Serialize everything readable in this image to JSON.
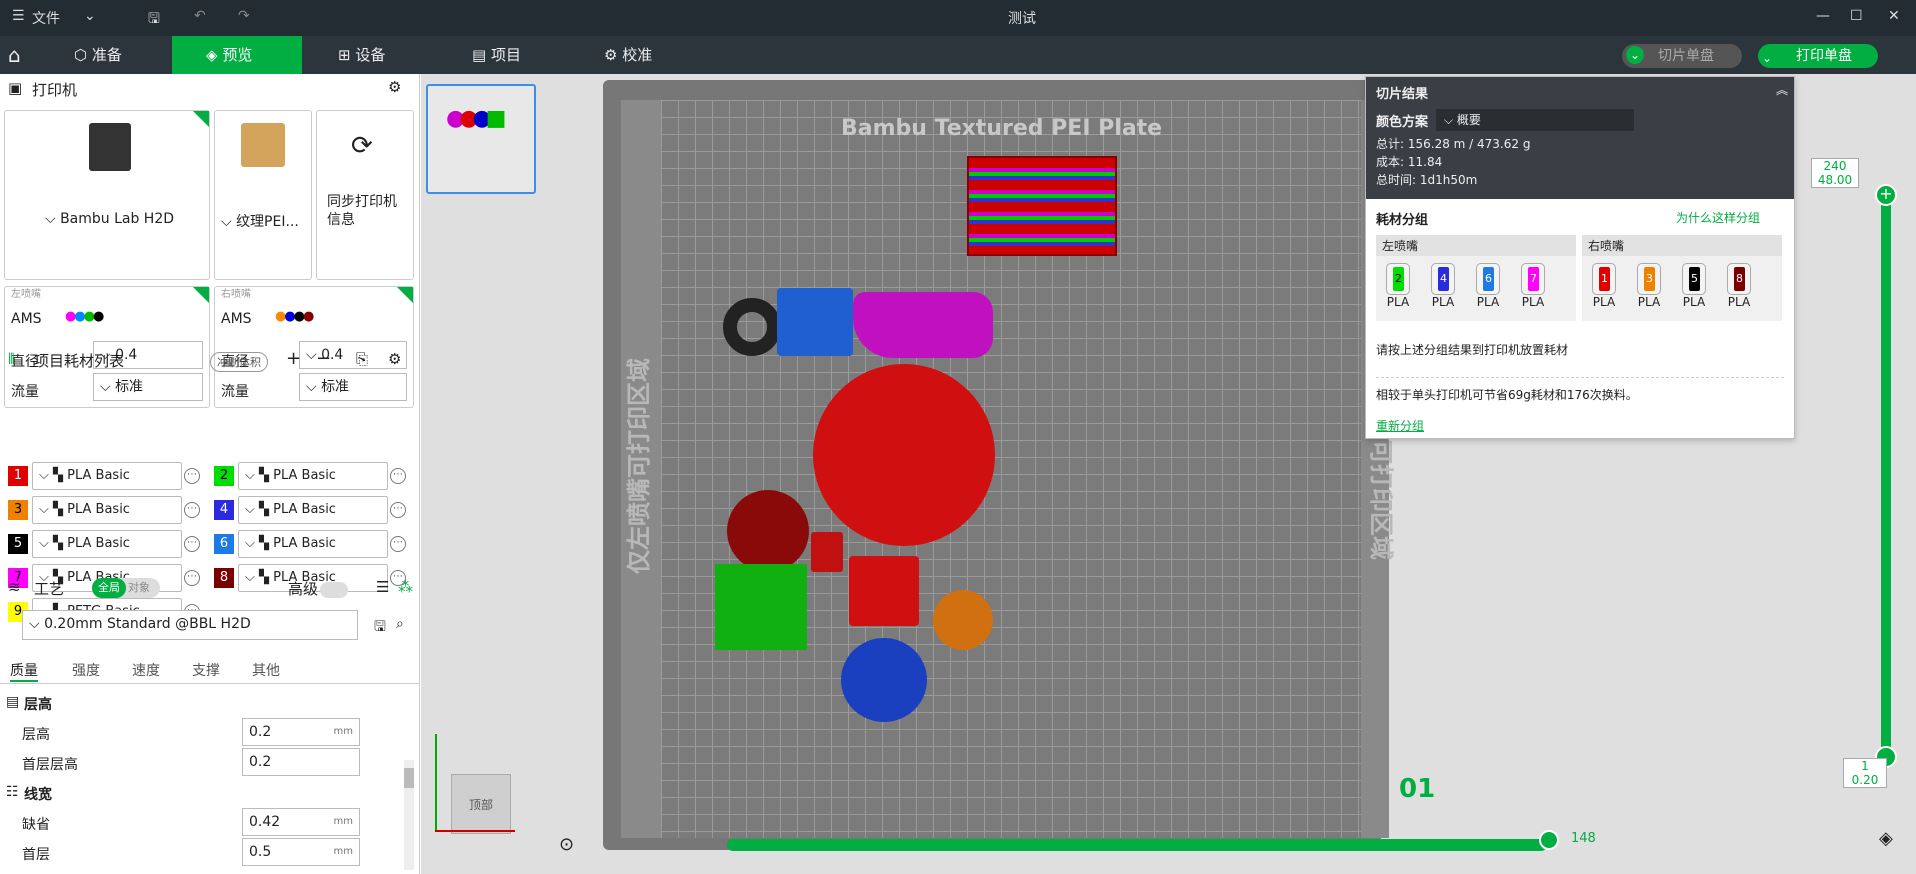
{
  "titlebar": {
    "file_menu": "文件",
    "title": "测试"
  },
  "tabs": {
    "home": "",
    "prepare": "准备",
    "preview": "预览",
    "device": "设备",
    "project": "项目",
    "calibrate": "校准"
  },
  "actions": {
    "slice_plate": "切片单盘",
    "print_plate": "打印单盘"
  },
  "printer": {
    "section": "打印机",
    "model": "Bambu Lab H2D",
    "plate": "纹理PEI...",
    "sync": "同步打印机信息"
  },
  "nozzles": {
    "left": {
      "label": "左喷嘴",
      "ams": "AMS",
      "diameter_label": "直径",
      "diameter": "0.4",
      "flow_label": "流量",
      "flow": "标准"
    },
    "right": {
      "label": "右喷嘴",
      "ams": "AMS",
      "diameter_label": "直径",
      "diameter": "0.4",
      "flow_label": "流量",
      "flow": "标准"
    }
  },
  "filaments": {
    "section": "项目耗材列表",
    "flush": "冲刷体积",
    "items": [
      {
        "num": "1",
        "name": "PLA Basic",
        "color": "#e10000"
      },
      {
        "num": "2",
        "name": "PLA Basic",
        "color": "#00dd00"
      },
      {
        "num": "3",
        "name": "PLA Basic",
        "color": "#f08000"
      },
      {
        "num": "4",
        "name": "PLA Basic",
        "color": "#2a2adf"
      },
      {
        "num": "5",
        "name": "PLA Basic",
        "color": "#000000"
      },
      {
        "num": "6",
        "name": "PLA Basic",
        "color": "#1e7be6"
      },
      {
        "num": "7",
        "name": "PLA Basic",
        "color": "#ff00ff"
      },
      {
        "num": "8",
        "name": "PLA Basic",
        "color": "#7a0000"
      },
      {
        "num": "9",
        "name": "PETG Basic",
        "color": "#ffff00"
      }
    ]
  },
  "process": {
    "section": "工艺",
    "global": "全局",
    "object": "对象",
    "advanced": "高级",
    "preset": "0.20mm Standard @BBL H2D",
    "tabs": [
      "质量",
      "强度",
      "速度",
      "支撑",
      "其他"
    ],
    "layer_height_group": "层高",
    "layer_height_label": "层高",
    "layer_height": "0.2",
    "first_layer_label": "首层层高",
    "first_layer": "0.2",
    "line_width_group": "线宽",
    "default_label": "缺省",
    "default": "0.42",
    "first_label": "首层",
    "first": "0.5",
    "unit": "mm"
  },
  "viewport": {
    "plate_name": "Bambu Textured PEI Plate",
    "left_only": "仅左喷嘴可打印区域",
    "right_only": "仅右喷嘴可打印区域",
    "plate_num": "01",
    "view_cube": "顶部",
    "layer_top": "240",
    "layer_top_h": "48.00",
    "layer_bottom": "1",
    "layer_bottom_h": "0.20",
    "move_end": "148"
  },
  "slice_result": {
    "title": "切片结果",
    "color_scheme_label": "颜色方案",
    "color_scheme": "概要",
    "total": "总计:  156.28 m / 473.62 g",
    "cost": "成本:  11.84",
    "time": "总时间:  1d1h50m",
    "grouping": "耗材分组",
    "why": "为什么这样分组",
    "left": "左喷嘴",
    "right": "右喷嘴",
    "pla": "PLA",
    "left_fils": [
      {
        "n": "2",
        "c": "#00dd00"
      },
      {
        "n": "4",
        "c": "#2a2adf"
      },
      {
        "n": "6",
        "c": "#1e7be6"
      },
      {
        "n": "7",
        "c": "#ff00ff"
      }
    ],
    "right_fils": [
      {
        "n": "1",
        "c": "#e10000"
      },
      {
        "n": "3",
        "c": "#f08000"
      },
      {
        "n": "5",
        "c": "#000000"
      },
      {
        "n": "8",
        "c": "#7a0000"
      }
    ],
    "hint": "请按上述分组结果到打印机放置耗材",
    "saving": "相较于单头打印机可节省69g耗材和176次换料。",
    "regroup": "重新分组"
  }
}
